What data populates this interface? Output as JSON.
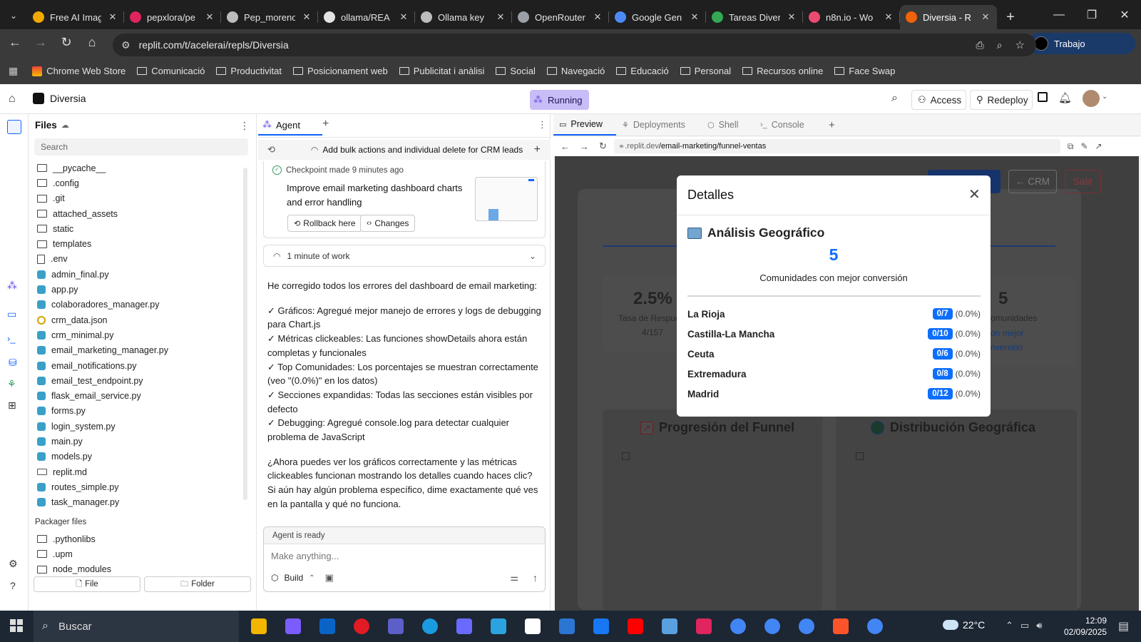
{
  "browser": {
    "tabs": [
      {
        "title": "Free AI Imag",
        "icon": "clock-favicon",
        "color": "#f2a900"
      },
      {
        "title": "pepxlora/pe",
        "icon": "red-app-favicon",
        "color": "#e0245e"
      },
      {
        "title": "Pep_moreno",
        "icon": "openai-favicon",
        "color": "#bdbdbd"
      },
      {
        "title": "ollama/REA",
        "icon": "github-favicon",
        "color": "#e3e3e3"
      },
      {
        "title": "Ollama key",
        "icon": "openai-favicon",
        "color": "#bdbdbd"
      },
      {
        "title": "OpenRouter",
        "icon": "openrouter-favicon",
        "color": "#9aa0a6"
      },
      {
        "title": "Google Gen",
        "icon": "gemini-favicon",
        "color": "#4c8bf5"
      },
      {
        "title": "Tareas Diver",
        "icon": "tasks-favicon",
        "color": "#34a853"
      },
      {
        "title": "n8n.io - Wo",
        "icon": "n8n-favicon",
        "color": "#ea4b71"
      },
      {
        "title": "Diversia - R",
        "icon": "replit-favicon",
        "color": "#f26207",
        "active": true
      }
    ],
    "url": "replit.com/t/acelerai/repls/Diversia",
    "profile_label": "Trabajo",
    "bookmarks": [
      "Chrome Web Store",
      "Comunicació",
      "Productivitat",
      "Posicionament web",
      "Publicitat i anàlisi",
      "Social",
      "Navegació",
      "Educació",
      "Personal",
      "Recursos online",
      "Face Swap"
    ]
  },
  "replit": {
    "project_name": "Diversia",
    "status": "Running",
    "access_label": "Access",
    "redeploy_label": "Redeploy"
  },
  "files": {
    "title": "Files",
    "search_placeholder": "Search",
    "items": [
      {
        "name": "__pycache__",
        "type": "folder"
      },
      {
        "name": ".config",
        "type": "folder"
      },
      {
        "name": ".git",
        "type": "folder"
      },
      {
        "name": "attached_assets",
        "type": "folder"
      },
      {
        "name": "static",
        "type": "folder"
      },
      {
        "name": "templates",
        "type": "folder"
      },
      {
        "name": ".env",
        "type": "file"
      },
      {
        "name": "admin_final.py",
        "type": "py"
      },
      {
        "name": "app.py",
        "type": "py"
      },
      {
        "name": "colaboradores_manager.py",
        "type": "py"
      },
      {
        "name": "crm_data.json",
        "type": "json"
      },
      {
        "name": "crm_minimal.py",
        "type": "py"
      },
      {
        "name": "email_marketing_manager.py",
        "type": "py"
      },
      {
        "name": "email_notifications.py",
        "type": "py"
      },
      {
        "name": "email_test_endpoint.py",
        "type": "py"
      },
      {
        "name": "flask_email_service.py",
        "type": "py"
      },
      {
        "name": "forms.py",
        "type": "py"
      },
      {
        "name": "login_system.py",
        "type": "py"
      },
      {
        "name": "main.py",
        "type": "py"
      },
      {
        "name": "models.py",
        "type": "py"
      },
      {
        "name": "replit.md",
        "type": "md"
      },
      {
        "name": "routes_simple.py",
        "type": "py"
      },
      {
        "name": "task_manager.py",
        "type": "py"
      }
    ],
    "packager_title": "Packager files",
    "packager_items": [
      {
        "name": ".pythonlibs",
        "type": "folder"
      },
      {
        "name": ".upm",
        "type": "folder"
      },
      {
        "name": "node_modules",
        "type": "folder"
      }
    ],
    "new_file_label": "File",
    "new_folder_label": "Folder"
  },
  "agent": {
    "tab_label": "Agent",
    "thread_title": "Add bulk actions and individual delete for CRM leads",
    "checkpoint_label": "Checkpoint made 9 minutes ago",
    "checkpoint_title": "Improve email marketing dashboard charts and error handling",
    "rollback_label": "Rollback here",
    "changes_label": "Changes",
    "work_label": "1 minute of work",
    "message_intro": "He corregido todos los errores del dashboard de email marketing:",
    "message_points": [
      "✓ Gráficos: Agregué mejor manejo de errores y logs de debugging para Chart.js",
      "✓ Métricas clickeables: Las funciones showDetails ahora están completas y funcionales",
      "✓ Top Comunidades: Los porcentajes se muestran correctamente (veo \"(0.0%)\" en los datos)",
      "✓ Secciones expandidas: Todas las secciones están visibles por defecto",
      "✓ Debugging: Agregué console.log para detectar cualquier problema de JavaScript"
    ],
    "message_outro": "¿Ahora puedes ver los gráficos correctamente y las métricas clickeables funcionan mostrando los detalles cuando haces clic? Si aún hay algún problema específico, dime exactamente qué ves en la pantalla y qué no funciona.",
    "ready_label": "Agent is ready",
    "input_placeholder": "Make anything...",
    "build_label": "Build"
  },
  "preview": {
    "tabs": [
      "Preview",
      "Deployments",
      "Shell",
      "Console"
    ],
    "url_host": ".replit.dev",
    "url_path": "/email-marketing/funnel-ventas",
    "crm_button": "← CRM",
    "exit_button": "Salir",
    "stat_left_value": "2.5%",
    "stat_left_label": "Tasa de Respue",
    "stat_left_sub": "4/157",
    "stat_right_value": "5",
    "stat_right_label": "omunidades",
    "stat_right_link_1": "on mejor",
    "stat_right_link_2": "nversión",
    "chart_title_left": "Progresión del Funnel",
    "chart_title_right": "Distribución Geográfica",
    "modal": {
      "title": "Detalles",
      "section_title": "Análisis Geográfico",
      "big_number": "5",
      "subtitle": "Comunidades con mejor conversión",
      "rows": [
        {
          "name": "La Rioja",
          "badge": "0/7",
          "pct": "(0.0%)"
        },
        {
          "name": "Castilla-La Mancha",
          "badge": "0/10",
          "pct": "(0.0%)"
        },
        {
          "name": "Ceuta",
          "badge": "0/6",
          "pct": "(0.0%)"
        },
        {
          "name": "Extremadura",
          "badge": "0/8",
          "pct": "(0.0%)"
        },
        {
          "name": "Madrid",
          "badge": "0/12",
          "pct": "(0.0%)"
        }
      ]
    }
  },
  "taskbar": {
    "search_label": "Buscar",
    "weather": "22°C",
    "time": "12:09",
    "date": "02/09/2025"
  }
}
